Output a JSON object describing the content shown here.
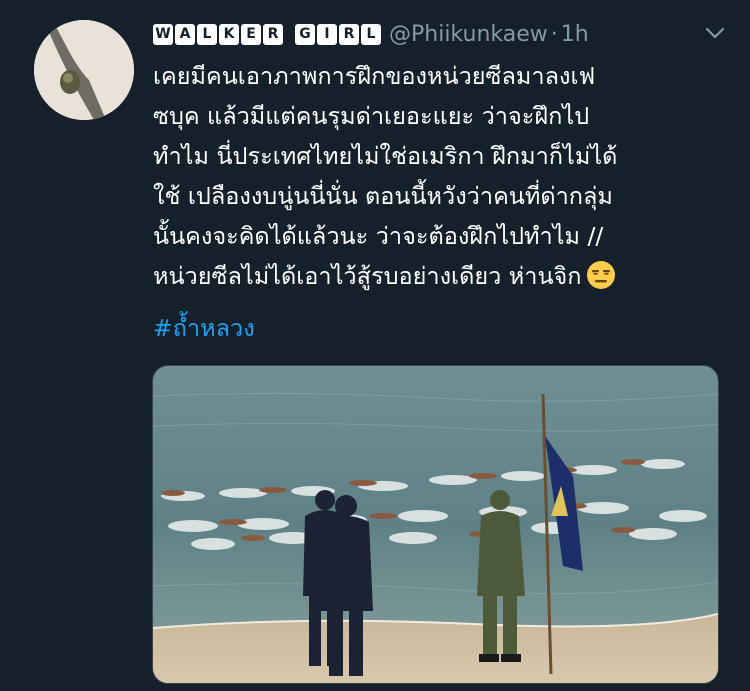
{
  "tweet": {
    "display_name_letters": [
      "W",
      "A",
      "L",
      "K",
      "E",
      "R",
      "",
      "G",
      "I",
      "R",
      "L"
    ],
    "handle": "@Phiikunkaew",
    "separator": "·",
    "time": "1h",
    "text_lines": [
      "เคยมีคนเอาภาพการฝึกของหน่วยซีลมาลงเฟ",
      "ซบุค แล้วมีแต่คนรุมด่าเยอะแยะ ว่าจะฝึกไป",
      "ทำไม นี่ประเทศไทยไม่ใช่อเมริกา ฝึกมาก็ไม่ได้",
      "ใช้ เปลืองงบนู่นนี่นั่น ตอนนี้หวังว่าคนที่ด่ากลุ่ม",
      "นั้นคงจะคิดได้แล้วนะ ว่าจะต้องฝึกไปทำไม //",
      "หน่วยซีลไม่ได้เอาไว้สู้รบอย่างเดียว ห่านจิก"
    ],
    "emoji": "expressionless-face",
    "hashtag": "#ถ้ำหลวง"
  },
  "colors": {
    "background": "#15202b",
    "text": "#ffffff",
    "muted": "#8899a6",
    "link": "#1da1f2"
  }
}
